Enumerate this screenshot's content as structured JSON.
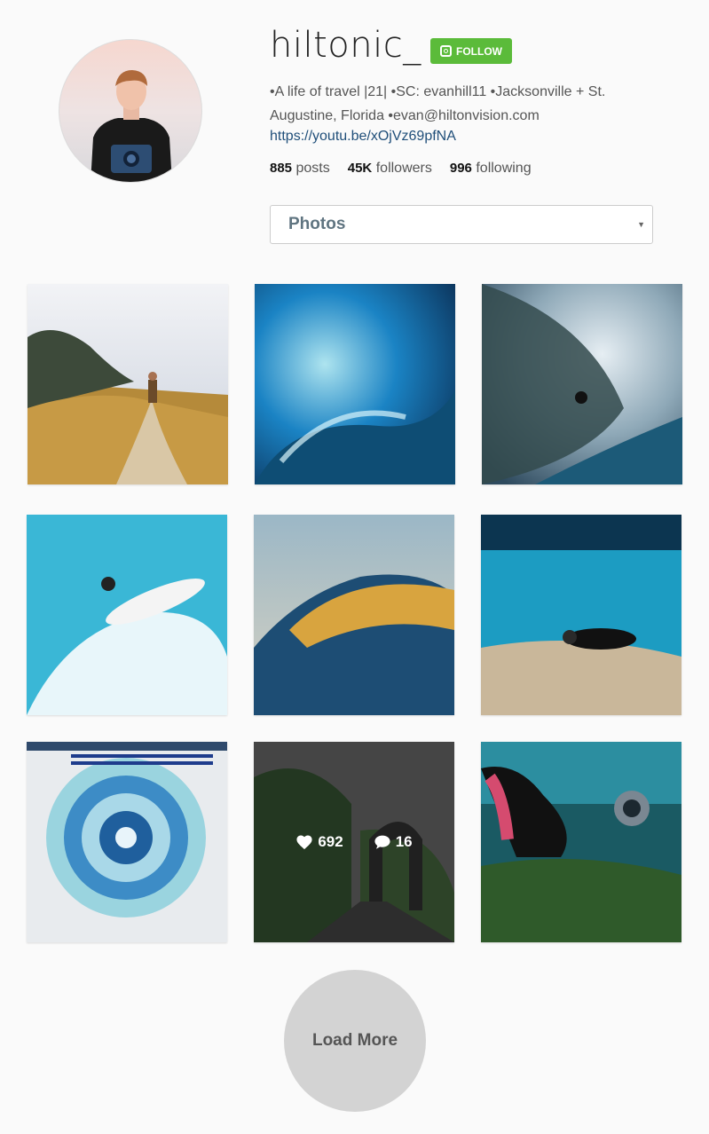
{
  "profile": {
    "username": "hiltonic_",
    "follow_label": "FOLLOW",
    "bio": "•A life of travel |21| •SC: evanhill11 •Jacksonville + St. Augustine, Florida •evan@hiltonvision.com",
    "link": "https://youtu.be/xOjVz69pfNA",
    "stats": {
      "posts_count": "885",
      "posts_label": "posts",
      "followers_count": "45K",
      "followers_label": "followers",
      "following_count": "996",
      "following_label": "following"
    }
  },
  "filter": {
    "selected": "Photos"
  },
  "grid": {
    "hovered_tile": {
      "likes": "692",
      "comments": "16"
    }
  },
  "load_more_label": "Load More",
  "colors": {
    "follow_green": "#5bbb3a",
    "link_blue": "#1f4e79",
    "load_more_gray": "#d3d3d3"
  }
}
